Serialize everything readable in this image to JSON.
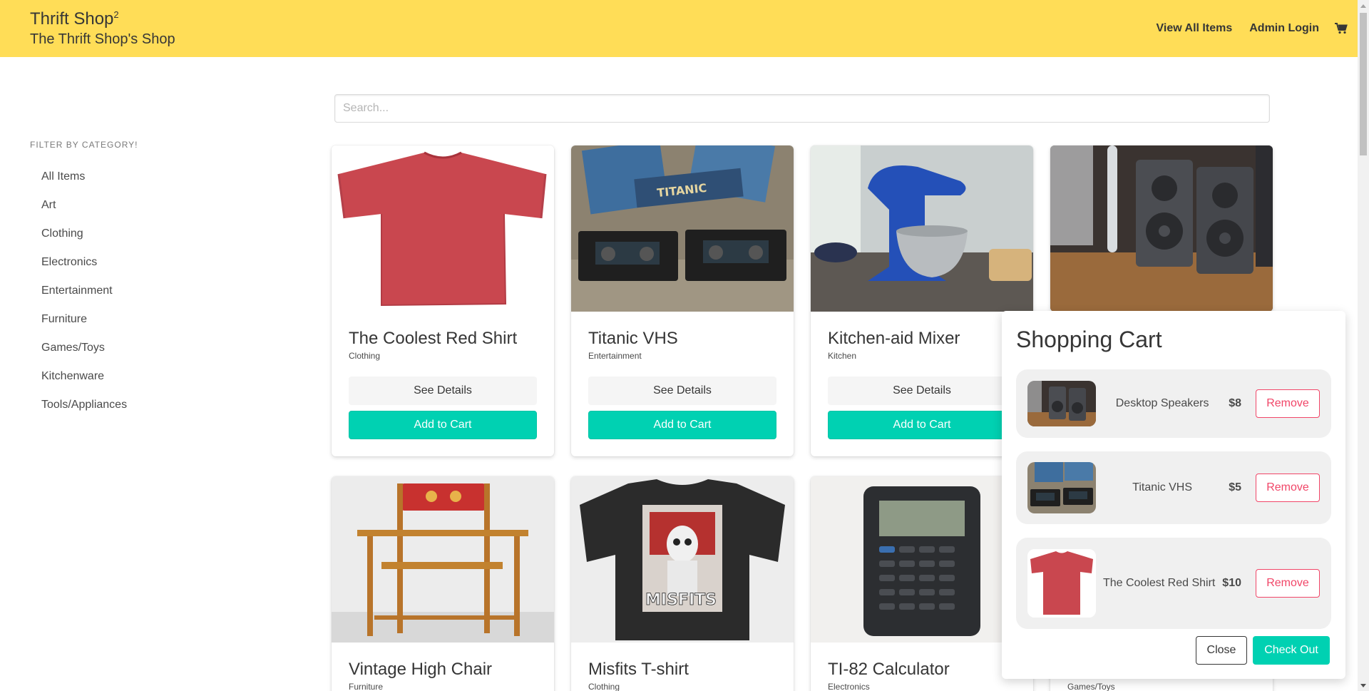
{
  "navbar": {
    "brand_title": "Thrift Shop",
    "brand_sup": "2",
    "brand_subtitle": "The Thrift Shop's Shop",
    "links": [
      "View All Items",
      "Admin Login"
    ],
    "cart_icon": "shopping-cart-icon",
    "background": "#ffdd57"
  },
  "search": {
    "placeholder": "Search...",
    "value": ""
  },
  "sidebar": {
    "label": "FILTER BY CATEGORY!",
    "items": [
      "All Items",
      "Art",
      "Clothing",
      "Electronics",
      "Entertainment",
      "Furniture",
      "Games/Toys",
      "Kitchenware",
      "Tools/Appliances"
    ]
  },
  "products": [
    {
      "title": "The Coolest Red Shirt",
      "category": "Clothing",
      "details_label": "See Details",
      "cart_label": "Add to Cart"
    },
    {
      "title": "Titanic VHS",
      "category": "Entertainment",
      "details_label": "See Details",
      "cart_label": "Add to Cart"
    },
    {
      "title": "Kitchen-aid Mixer",
      "category": "Kitchen",
      "details_label": "See Details",
      "cart_label": "Add to Cart"
    },
    {
      "title": "Desktop Speakers"
    },
    {
      "title": "Vintage High Chair",
      "category": "Furniture"
    },
    {
      "title": "Misfits T-shirt",
      "category": "Clothing"
    },
    {
      "title": "TI-82 Calculator",
      "category": "Electronics"
    },
    {
      "category": "Games/Toys"
    }
  ],
  "cart": {
    "title": "Shopping Cart",
    "items": [
      {
        "name": "Desktop Speakers",
        "price": "$8",
        "remove_label": "Remove"
      },
      {
        "name": "Titanic VHS",
        "price": "$5",
        "remove_label": "Remove"
      },
      {
        "name": "The Coolest Red Shirt",
        "price": "$10",
        "remove_label": "Remove"
      }
    ],
    "close_label": "Close",
    "checkout_label": "Check Out"
  },
  "colors": {
    "primary": "#00d1b2",
    "danger": "#f14668",
    "warning": "#ffdd57"
  }
}
